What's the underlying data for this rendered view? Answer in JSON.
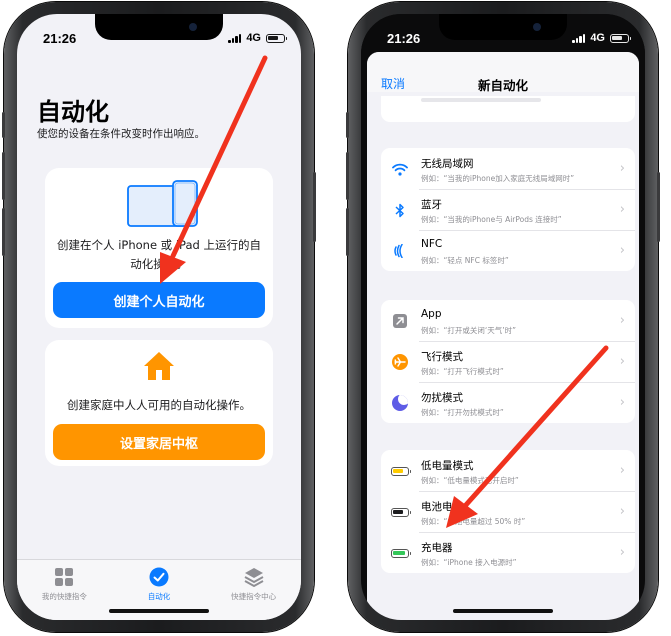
{
  "left_phone": {
    "status": {
      "time": "21:26",
      "network": "4G"
    },
    "title": "自动化",
    "subtitle": "使您的设备在条件改变时作出响应。",
    "personal_card": {
      "description": "创建在个人 iPhone 或 iPad 上运行的自动化操作。",
      "button_label": "创建个人自动化"
    },
    "home_card": {
      "description": "创建家庭中人人可用的自动化操作。",
      "button_label": "设置家居中枢"
    },
    "tabbar": [
      {
        "label": "我的快捷指令",
        "icon": "grid-icon"
      },
      {
        "label": "自动化",
        "icon": "automation-check-icon"
      },
      {
        "label": "快捷指令中心",
        "icon": "layers-icon"
      }
    ]
  },
  "right_phone": {
    "status": {
      "time": "21:26",
      "network": "4G"
    },
    "nav": {
      "cancel_label": "取消",
      "title": "新自动化"
    },
    "groups": [
      {
        "rows": [
          {
            "name": "无线局域网",
            "example": "例如：“当我的iPhone加入家庭无线局域网时”",
            "icon": "wifi-icon"
          },
          {
            "name": "蓝牙",
            "example": "例如：“当我的iPhone与 AirPods 连接时”",
            "icon": "bluetooth-icon"
          },
          {
            "name": "NFC",
            "example": "例如：“轻点 NFC 标签时”",
            "icon": "nfc-icon"
          }
        ]
      },
      {
        "rows": [
          {
            "name": "App",
            "example": "例如：“打开或关闭‘天气’时”",
            "icon": "app-arrow-icon"
          },
          {
            "name": "飞行模式",
            "example": "例如：“打开飞行模式时”",
            "icon": "airplane-icon"
          },
          {
            "name": "勿扰模式",
            "example": "例如：“打开勿扰模式时”",
            "icon": "moon-icon"
          }
        ]
      },
      {
        "rows": [
          {
            "name": "低电量模式",
            "example": "例如：“低电量模式已开启时”",
            "icon": "low-battery-icon"
          },
          {
            "name": "电池电量",
            "example": "例如：“电池电量超过 50% 时”",
            "icon": "battery-icon"
          },
          {
            "name": "充电器",
            "example": "例如：“iPhone 接入电源时”",
            "icon": "charging-battery-icon"
          }
        ]
      }
    ]
  },
  "colors": {
    "blue": "#0a7aff",
    "orange": "#ff9500",
    "arrow_red": "#f0321e",
    "background": "#f2f2f7"
  }
}
